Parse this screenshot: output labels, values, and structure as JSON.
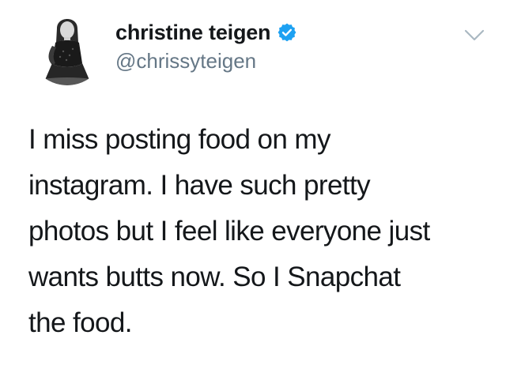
{
  "tweet": {
    "author": {
      "display_name": "christine teigen",
      "handle": "@chrissyteigen",
      "verified": true,
      "avatar_icon": "profile-photo-icon",
      "verified_icon": "verified-badge-icon"
    },
    "menu_icon": "chevron-down-icon",
    "text": "I miss posting food on my\ninstagram. I have such pretty\nphotos but I feel like everyone just\nwants butts now. So I Snapchat\nthe food."
  },
  "colors": {
    "text": "#14171a",
    "handle": "#657786",
    "verified_blue": "#1da1f2",
    "caret": "#aab8c2"
  }
}
